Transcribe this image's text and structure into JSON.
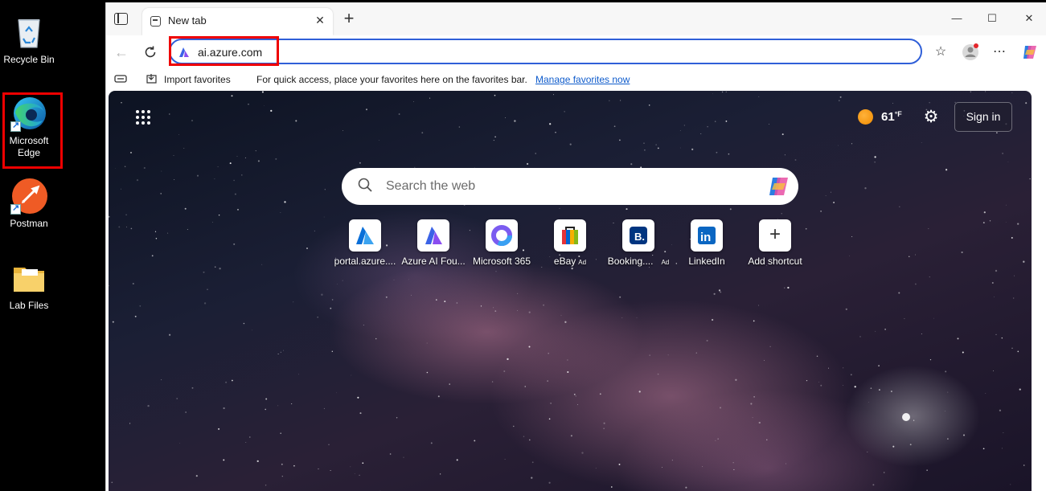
{
  "desktop": {
    "icons": [
      {
        "label": "Recycle Bin",
        "icon": "recycle-bin-icon"
      },
      {
        "label": "Microsoft Edge",
        "icon": "edge-icon"
      },
      {
        "label": "Postman",
        "icon": "postman-icon"
      },
      {
        "label": "Lab Files",
        "icon": "folder-icon"
      }
    ]
  },
  "browser": {
    "tab": {
      "title": "New tab",
      "close": "✕"
    },
    "new_tab": "+",
    "window": {
      "minimize": "—",
      "maximize": "☐",
      "close": "✕"
    },
    "address": {
      "url": "ai.azure.com"
    },
    "favorites_bar": {
      "import_label": "Import favorites",
      "message": "For quick access, place your favorites here on the favorites bar.",
      "manage_link": "Manage favorites now"
    }
  },
  "ntp": {
    "weather": {
      "temp": "61",
      "unit": "°F"
    },
    "sign_in": "Sign in",
    "search_placeholder": "Search the web",
    "tiles": [
      {
        "label": "portal.azure....",
        "ad": ""
      },
      {
        "label": "Azure AI Fou...",
        "ad": ""
      },
      {
        "label": "Microsoft 365",
        "ad": ""
      },
      {
        "label": "eBay",
        "ad": "Ad"
      },
      {
        "label": "Booking....",
        "ad": "Ad"
      },
      {
        "label": "LinkedIn",
        "ad": ""
      },
      {
        "label": "Add shortcut",
        "ad": ""
      }
    ]
  },
  "colors": {
    "accent": "#2f5fd8",
    "highlight": "#e00000",
    "link": "#0f5ccc"
  }
}
